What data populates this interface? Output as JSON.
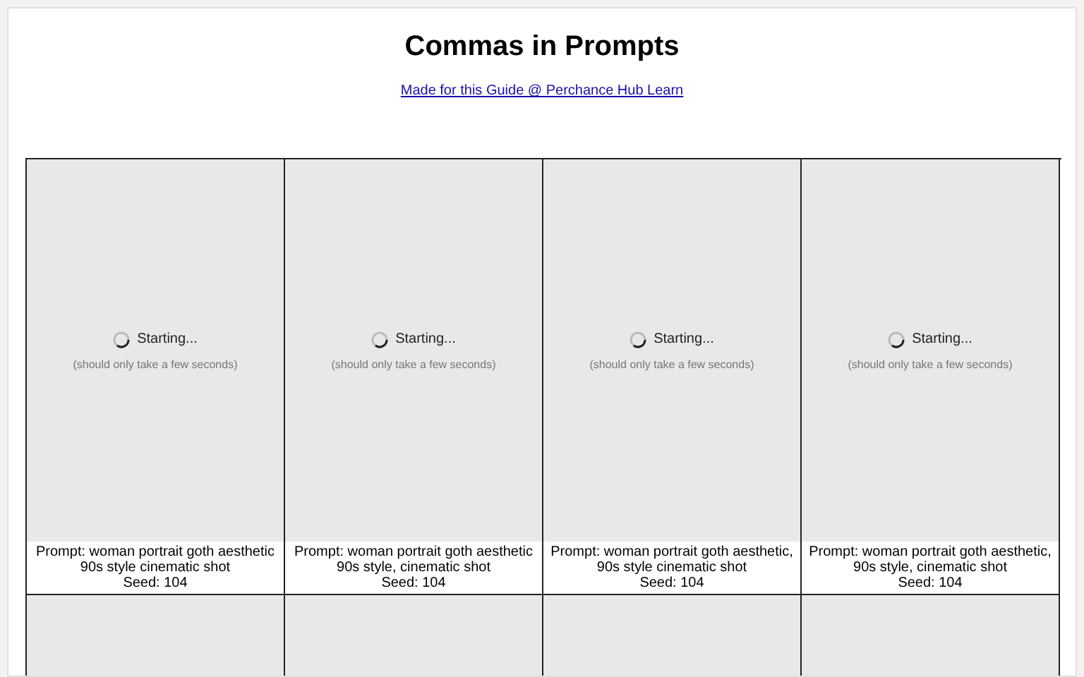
{
  "title": "Commas in Prompts",
  "link": "Made for this Guide @ Perchance Hub Learn",
  "cells": [
    {
      "kind": "loading",
      "status": "Starting...",
      "hint": "(should only take a few seconds)",
      "prompt": "Prompt: woman portrait goth aesthetic 90s style cinematic shot",
      "seed": "Seed: 104"
    },
    {
      "kind": "loading",
      "status": "Starting...",
      "hint": "(should only take a few seconds)",
      "prompt": "Prompt: woman portrait goth aesthetic 90s style, cinematic shot",
      "seed": "Seed: 104"
    },
    {
      "kind": "loading",
      "status": "Starting...",
      "hint": "(should only take a few seconds)",
      "prompt": "Prompt: woman portrait goth aesthetic, 90s style cinematic shot",
      "seed": "Seed: 104"
    },
    {
      "kind": "loading",
      "status": "Starting...",
      "hint": "(should only take a few seconds)",
      "prompt": "Prompt: woman portrait goth aesthetic, 90s style, cinematic shot",
      "seed": "Seed: 104"
    },
    {
      "kind": "empty"
    },
    {
      "kind": "empty"
    },
    {
      "kind": "empty"
    },
    {
      "kind": "empty"
    }
  ]
}
